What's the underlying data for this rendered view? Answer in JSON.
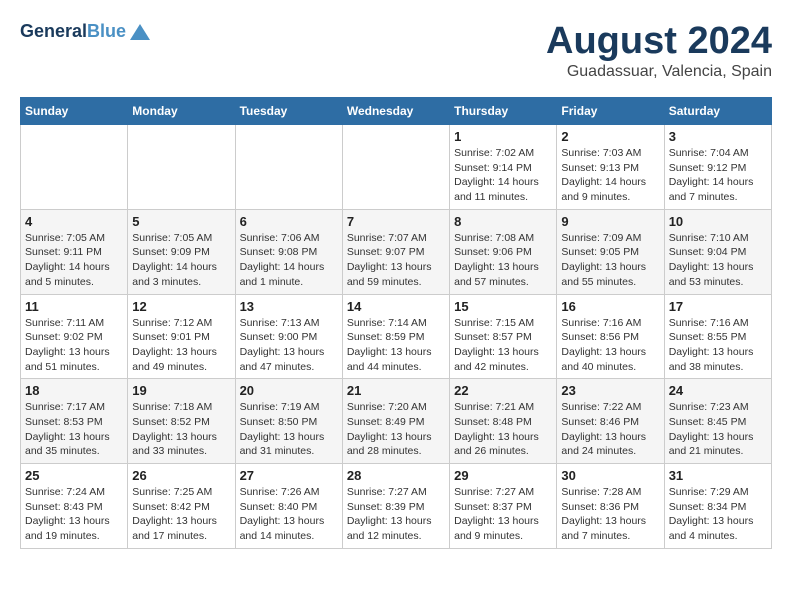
{
  "header": {
    "logo_line1": "General",
    "logo_line2": "Blue",
    "month": "August 2024",
    "location": "Guadassuar, Valencia, Spain"
  },
  "weekdays": [
    "Sunday",
    "Monday",
    "Tuesday",
    "Wednesday",
    "Thursday",
    "Friday",
    "Saturday"
  ],
  "weeks": [
    [
      {
        "day": "",
        "info": ""
      },
      {
        "day": "",
        "info": ""
      },
      {
        "day": "",
        "info": ""
      },
      {
        "day": "",
        "info": ""
      },
      {
        "day": "1",
        "info": "Sunrise: 7:02 AM\nSunset: 9:14 PM\nDaylight: 14 hours\nand 11 minutes."
      },
      {
        "day": "2",
        "info": "Sunrise: 7:03 AM\nSunset: 9:13 PM\nDaylight: 14 hours\nand 9 minutes."
      },
      {
        "day": "3",
        "info": "Sunrise: 7:04 AM\nSunset: 9:12 PM\nDaylight: 14 hours\nand 7 minutes."
      }
    ],
    [
      {
        "day": "4",
        "info": "Sunrise: 7:05 AM\nSunset: 9:11 PM\nDaylight: 14 hours\nand 5 minutes."
      },
      {
        "day": "5",
        "info": "Sunrise: 7:05 AM\nSunset: 9:09 PM\nDaylight: 14 hours\nand 3 minutes."
      },
      {
        "day": "6",
        "info": "Sunrise: 7:06 AM\nSunset: 9:08 PM\nDaylight: 14 hours\nand 1 minute."
      },
      {
        "day": "7",
        "info": "Sunrise: 7:07 AM\nSunset: 9:07 PM\nDaylight: 13 hours\nand 59 minutes."
      },
      {
        "day": "8",
        "info": "Sunrise: 7:08 AM\nSunset: 9:06 PM\nDaylight: 13 hours\nand 57 minutes."
      },
      {
        "day": "9",
        "info": "Sunrise: 7:09 AM\nSunset: 9:05 PM\nDaylight: 13 hours\nand 55 minutes."
      },
      {
        "day": "10",
        "info": "Sunrise: 7:10 AM\nSunset: 9:04 PM\nDaylight: 13 hours\nand 53 minutes."
      }
    ],
    [
      {
        "day": "11",
        "info": "Sunrise: 7:11 AM\nSunset: 9:02 PM\nDaylight: 13 hours\nand 51 minutes."
      },
      {
        "day": "12",
        "info": "Sunrise: 7:12 AM\nSunset: 9:01 PM\nDaylight: 13 hours\nand 49 minutes."
      },
      {
        "day": "13",
        "info": "Sunrise: 7:13 AM\nSunset: 9:00 PM\nDaylight: 13 hours\nand 47 minutes."
      },
      {
        "day": "14",
        "info": "Sunrise: 7:14 AM\nSunset: 8:59 PM\nDaylight: 13 hours\nand 44 minutes."
      },
      {
        "day": "15",
        "info": "Sunrise: 7:15 AM\nSunset: 8:57 PM\nDaylight: 13 hours\nand 42 minutes."
      },
      {
        "day": "16",
        "info": "Sunrise: 7:16 AM\nSunset: 8:56 PM\nDaylight: 13 hours\nand 40 minutes."
      },
      {
        "day": "17",
        "info": "Sunrise: 7:16 AM\nSunset: 8:55 PM\nDaylight: 13 hours\nand 38 minutes."
      }
    ],
    [
      {
        "day": "18",
        "info": "Sunrise: 7:17 AM\nSunset: 8:53 PM\nDaylight: 13 hours\nand 35 minutes."
      },
      {
        "day": "19",
        "info": "Sunrise: 7:18 AM\nSunset: 8:52 PM\nDaylight: 13 hours\nand 33 minutes."
      },
      {
        "day": "20",
        "info": "Sunrise: 7:19 AM\nSunset: 8:50 PM\nDaylight: 13 hours\nand 31 minutes."
      },
      {
        "day": "21",
        "info": "Sunrise: 7:20 AM\nSunset: 8:49 PM\nDaylight: 13 hours\nand 28 minutes."
      },
      {
        "day": "22",
        "info": "Sunrise: 7:21 AM\nSunset: 8:48 PM\nDaylight: 13 hours\nand 26 minutes."
      },
      {
        "day": "23",
        "info": "Sunrise: 7:22 AM\nSunset: 8:46 PM\nDaylight: 13 hours\nand 24 minutes."
      },
      {
        "day": "24",
        "info": "Sunrise: 7:23 AM\nSunset: 8:45 PM\nDaylight: 13 hours\nand 21 minutes."
      }
    ],
    [
      {
        "day": "25",
        "info": "Sunrise: 7:24 AM\nSunset: 8:43 PM\nDaylight: 13 hours\nand 19 minutes."
      },
      {
        "day": "26",
        "info": "Sunrise: 7:25 AM\nSunset: 8:42 PM\nDaylight: 13 hours\nand 17 minutes."
      },
      {
        "day": "27",
        "info": "Sunrise: 7:26 AM\nSunset: 8:40 PM\nDaylight: 13 hours\nand 14 minutes."
      },
      {
        "day": "28",
        "info": "Sunrise: 7:27 AM\nSunset: 8:39 PM\nDaylight: 13 hours\nand 12 minutes."
      },
      {
        "day": "29",
        "info": "Sunrise: 7:27 AM\nSunset: 8:37 PM\nDaylight: 13 hours\nand 9 minutes."
      },
      {
        "day": "30",
        "info": "Sunrise: 7:28 AM\nSunset: 8:36 PM\nDaylight: 13 hours\nand 7 minutes."
      },
      {
        "day": "31",
        "info": "Sunrise: 7:29 AM\nSunset: 8:34 PM\nDaylight: 13 hours\nand 4 minutes."
      }
    ]
  ]
}
